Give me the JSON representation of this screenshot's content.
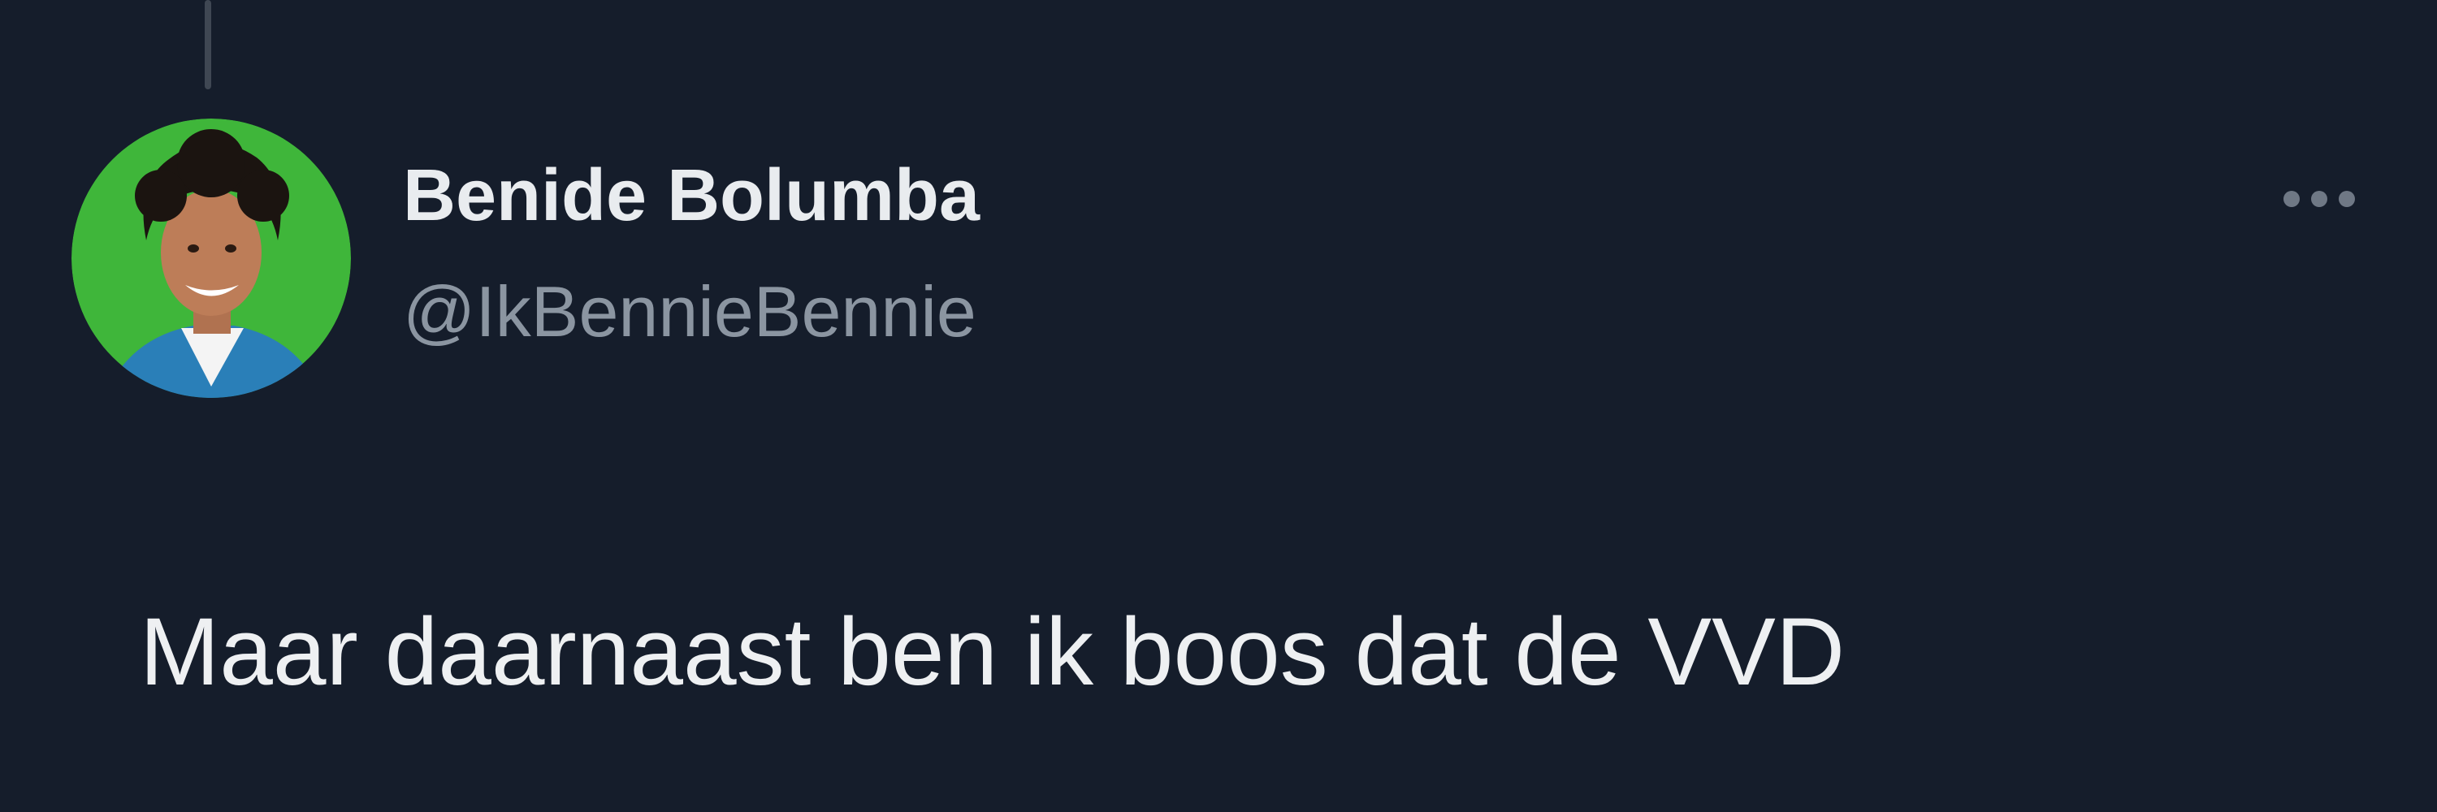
{
  "tweet": {
    "author": {
      "display_name": "Benide Bolumba",
      "handle": "@IkBennieBennie",
      "avatar_icon": "profile-photo",
      "avatar_background": "#3fb63a"
    },
    "text": "Maar daarnaast ben ik boos dat de VVD",
    "more_icon": "more-options-icon"
  },
  "colors": {
    "background": "#151d2b",
    "name_text": "#e9ecef",
    "handle_text": "#8b95a1",
    "body_text": "#eef0f2",
    "thread_line": "#3f4753"
  }
}
